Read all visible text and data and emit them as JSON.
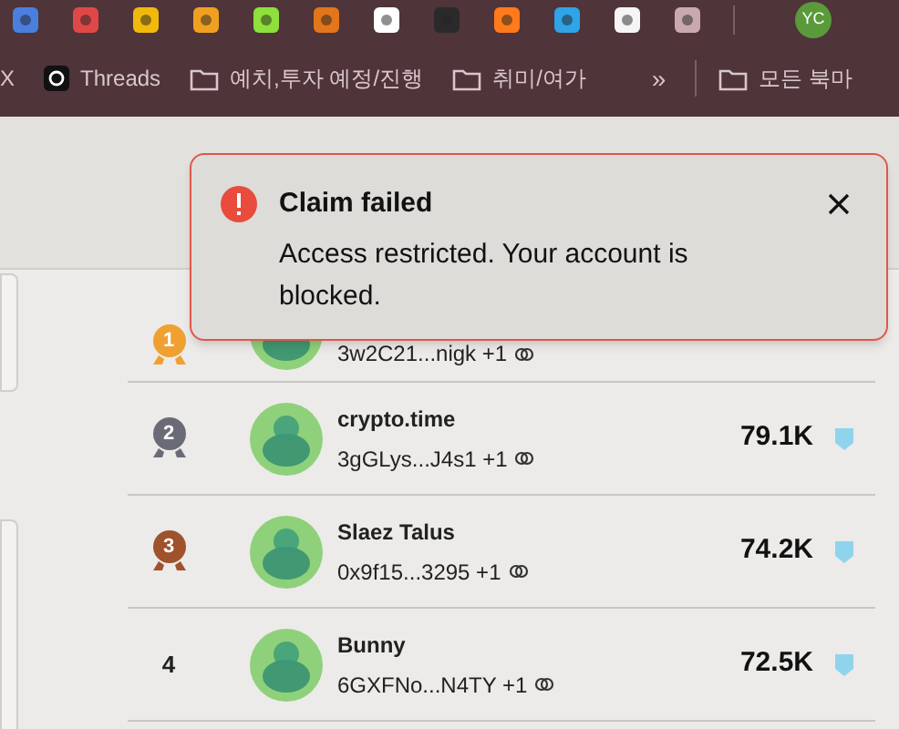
{
  "extensions": [
    {
      "color": "#4a7fe0"
    },
    {
      "color": "#e04848"
    },
    {
      "color": "#f0b90b"
    },
    {
      "color": "#f0a020"
    },
    {
      "color": "#8ee03a"
    },
    {
      "color": "#e2761b"
    },
    {
      "color": "#ffffff"
    },
    {
      "color": "#2a2a2a"
    },
    {
      "color": "#ff7a1a"
    },
    {
      "color": "#2fa4e7"
    },
    {
      "color": "#f5f5f5"
    },
    {
      "color": "#c9a9ae"
    }
  ],
  "profile": {
    "initials": "YC"
  },
  "bookmarks": [
    {
      "kind": "text",
      "label": "X"
    },
    {
      "kind": "app",
      "label": "Threads"
    },
    {
      "kind": "folder",
      "label": "예치,투자 예정/진행"
    },
    {
      "kind": "folder",
      "label": "취미/여가"
    },
    {
      "kind": "overflow",
      "label": "»"
    },
    {
      "kind": "folder",
      "label": "모든 북마"
    }
  ],
  "toast": {
    "title": "Claim failed",
    "message": "Access restricted. Your account is blocked."
  },
  "rows": [
    {
      "kind": "medal",
      "rank": "1",
      "color": "#f0a030",
      "address": "3w2C21...nigk +1"
    },
    {
      "kind": "medal",
      "rank": "2",
      "color": "#6b6b78",
      "name": "crypto.time",
      "address": "3gGLys...J4s1 +1",
      "score": "79.1K"
    },
    {
      "kind": "medal",
      "rank": "3",
      "color": "#a0522d",
      "name": "Slaez Talus",
      "address": "0x9f15...3295 +1",
      "score": "74.2K"
    },
    {
      "kind": "number",
      "rank": "4",
      "name": "Bunny",
      "address": "6GXFNo...N4TY +1",
      "score": "72.5K"
    }
  ]
}
